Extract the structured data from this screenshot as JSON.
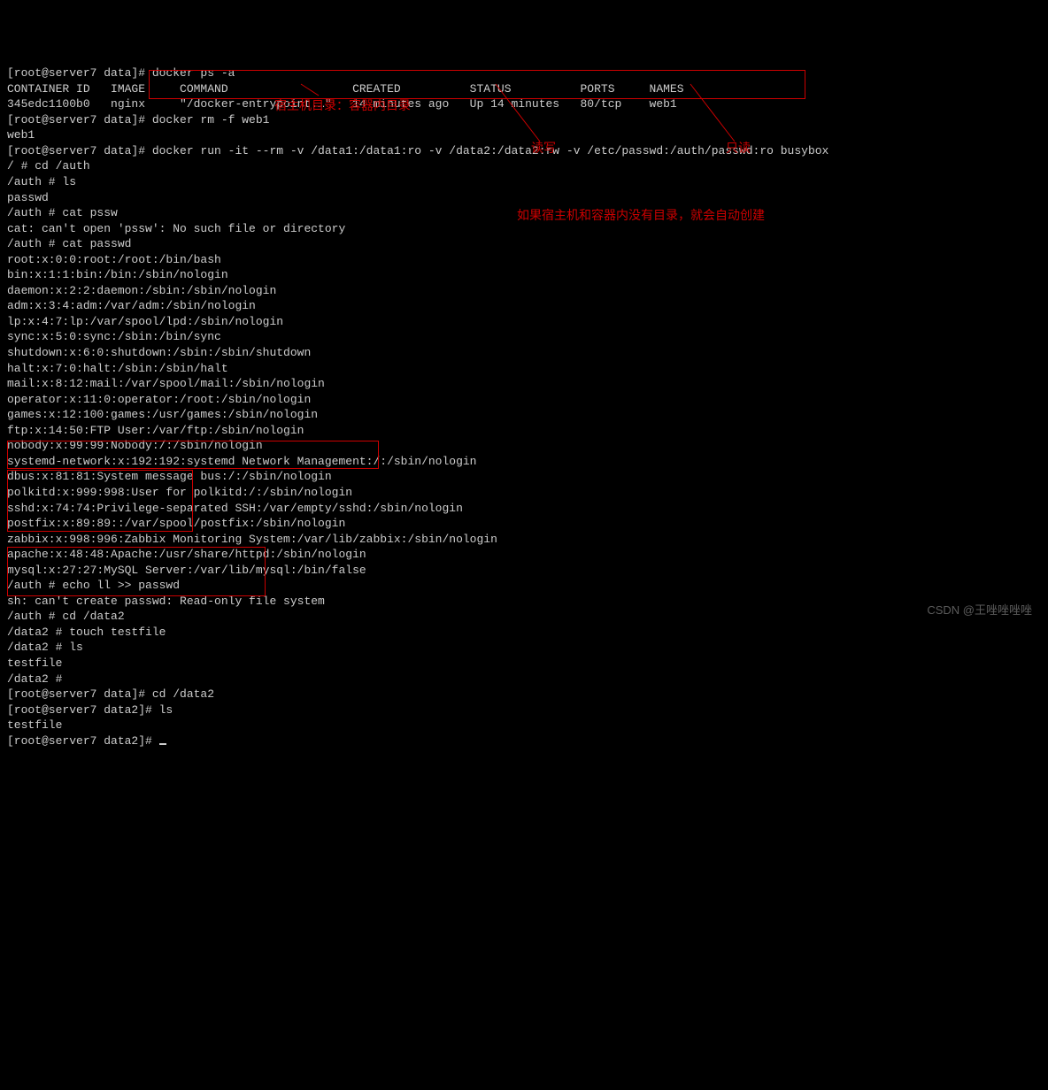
{
  "terminal": {
    "lines": [
      "[root@server7 data]# docker ps -a",
      "CONTAINER ID   IMAGE     COMMAND                  CREATED          STATUS          PORTS     NAMES",
      "345edc1100b0   nginx     \"/docker-entrypoint.…\"   14 minutes ago   Up 14 minutes   80/tcp    web1",
      "[root@server7 data]# docker rm -f web1",
      "web1",
      "[root@server7 data]# docker run -it --rm -v /data1:/data1:ro -v /data2:/data2:rw -v /etc/passwd:/auth/passwd:ro busybox",
      "/ # cd /auth",
      "/auth # ls",
      "passwd",
      "/auth # cat pssw",
      "cat: can't open 'pssw': No such file or directory",
      "/auth # cat passwd",
      "root:x:0:0:root:/root:/bin/bash",
      "bin:x:1:1:bin:/bin:/sbin/nologin",
      "daemon:x:2:2:daemon:/sbin:/sbin/nologin",
      "adm:x:3:4:adm:/var/adm:/sbin/nologin",
      "lp:x:4:7:lp:/var/spool/lpd:/sbin/nologin",
      "sync:x:5:0:sync:/sbin:/bin/sync",
      "shutdown:x:6:0:shutdown:/sbin:/sbin/shutdown",
      "halt:x:7:0:halt:/sbin:/sbin/halt",
      "mail:x:8:12:mail:/var/spool/mail:/sbin/nologin",
      "operator:x:11:0:operator:/root:/sbin/nologin",
      "games:x:12:100:games:/usr/games:/sbin/nologin",
      "ftp:x:14:50:FTP User:/var/ftp:/sbin/nologin",
      "nobody:x:99:99:Nobody:/:/sbin/nologin",
      "systemd-network:x:192:192:systemd Network Management:/:/sbin/nologin",
      "dbus:x:81:81:System message bus:/:/sbin/nologin",
      "polkitd:x:999:998:User for polkitd:/:/sbin/nologin",
      "sshd:x:74:74:Privilege-separated SSH:/var/empty/sshd:/sbin/nologin",
      "postfix:x:89:89::/var/spool/postfix:/sbin/nologin",
      "zabbix:x:998:996:Zabbix Monitoring System:/var/lib/zabbix:/sbin/nologin",
      "apache:x:48:48:Apache:/usr/share/httpd:/sbin/nologin",
      "mysql:x:27:27:MySQL Server:/var/lib/mysql:/bin/false",
      "/auth # echo ll >> passwd",
      "sh: can't create passwd: Read-only file system",
      "/auth # cd /data2",
      "/data2 # touch testfile",
      "/data2 # ls",
      "testfile",
      "/data2 # ",
      "[root@server7 data]# cd /data2",
      "[root@server7 data2]# ls",
      "testfile",
      "[root@server7 data2]# "
    ]
  },
  "annotations": {
    "host_container_dir": "宿主机目录：容器内目录",
    "read_write": "读写",
    "read_only": "只读",
    "auto_create": "如果宿主机和容器内没有目录，就会自动创建"
  },
  "watermark": "CSDN @王唑唑唑唑"
}
